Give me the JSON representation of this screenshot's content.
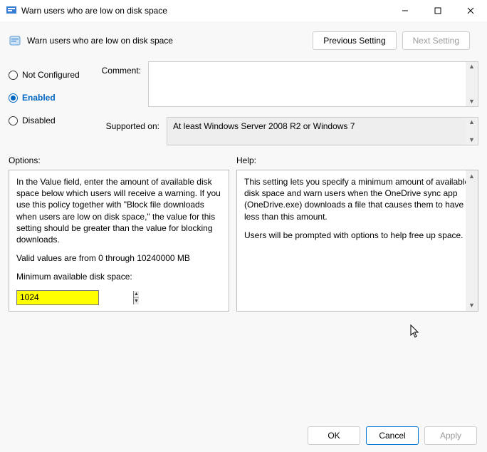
{
  "window": {
    "title": "Warn users who are low on disk space"
  },
  "header": {
    "policy_title": "Warn users who are low on disk space"
  },
  "nav": {
    "prev": "Previous Setting",
    "next": "Next Setting"
  },
  "state_labels": {
    "not_configured": "Not Configured",
    "enabled": "Enabled",
    "disabled": "Disabled"
  },
  "selected_state": "enabled",
  "labels": {
    "comment": "Comment:",
    "supported": "Supported on:",
    "options": "Options:",
    "help": "Help:"
  },
  "supported_text": "At least Windows Server 2008 R2 or Windows 7",
  "options": {
    "para1": "In the Value field, enter the amount of available disk space below which users will receive a warning. If you use this policy together with \"Block file downloads when users are low on disk space,\" the value for this setting should be greater than the value for blocking downloads.",
    "para2": "Valid values are from 0 through 10240000 MB",
    "field_label": "Minimum available disk space:",
    "value": "1024"
  },
  "help": {
    "para1": "This setting lets you specify a minimum amount of available disk space and warn users when the OneDrive sync app (OneDrive.exe) downloads a file that causes them to have less than this amount.",
    "para2": "Users will be prompted with options to help free up space."
  },
  "buttons": {
    "ok": "OK",
    "cancel": "Cancel",
    "apply": "Apply"
  }
}
